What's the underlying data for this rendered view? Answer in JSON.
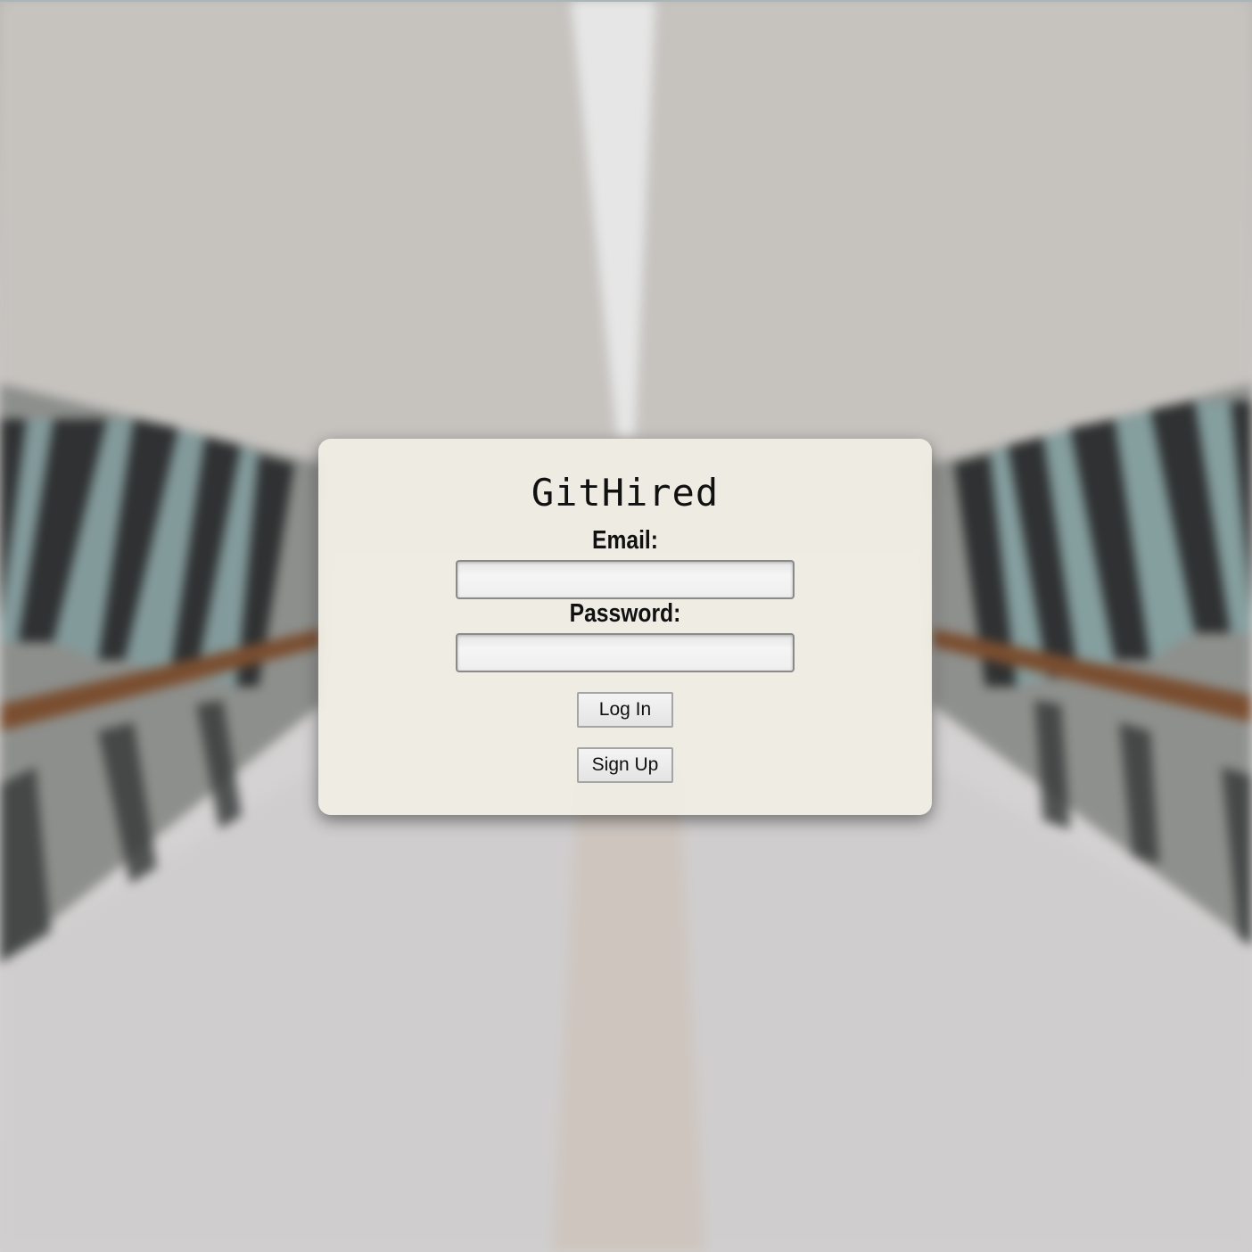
{
  "app": {
    "title": "GitHired"
  },
  "login_form": {
    "email_label": "Email:",
    "email_value": "",
    "password_label": "Password:",
    "password_value": "",
    "login_button": "Log In",
    "signup_button": "Sign Up"
  }
}
